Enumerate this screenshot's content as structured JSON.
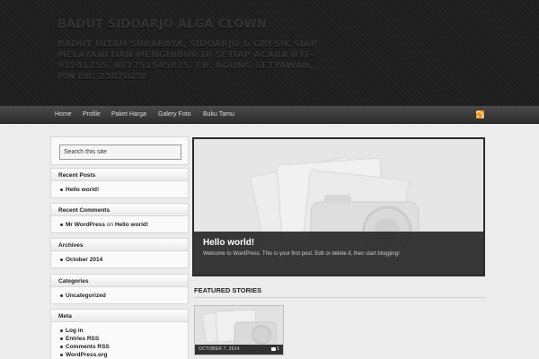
{
  "header": {
    "site_title": "BADUT SIDOARJO ALGA CLOWN",
    "site_description": "BADUT ULTAH SURABAYA, SIDOARJO & GRESIK SIAP MELAYANI DAN MENGHIBUR DI SETIAP ACARA 031-91241255, 087751545835. FB: AGUNG SETYAWAN, PIN BB: 2587025F"
  },
  "nav": {
    "items": [
      "Home",
      "Profile",
      "Paket Harga",
      "Galery Foto",
      "Buku Tamu"
    ],
    "rss_icon": "rss-icon"
  },
  "sidebar": {
    "search_placeholder": "Search this site",
    "recent_posts": {
      "title": "Recent Posts",
      "items": [
        "Hello world!"
      ]
    },
    "recent_comments": {
      "title": "Recent Comments",
      "author": "Mr WordPress",
      "on": "on",
      "post": "Hello world!"
    },
    "archives": {
      "title": "Archives",
      "items": [
        "October 2014"
      ]
    },
    "categories": {
      "title": "Categories",
      "items": [
        "Uncategorized"
      ]
    },
    "meta": {
      "title": "Meta",
      "items": [
        "Log in",
        "Entries RSS",
        "Comments RSS",
        "WordPress.org"
      ]
    }
  },
  "slider": {
    "title": "Hello world!",
    "excerpt": "Welcome to WordPress. This is your first post. Edit or delete it, then start blogging!"
  },
  "featured": {
    "heading": "FEATURED STORIES",
    "story": {
      "date": "OCTOBER 7, 2014",
      "comments": "1"
    }
  },
  "colors": {
    "header_bg": "#1e1e1e",
    "nav_bg": "#3a3a3a",
    "page_bg": "#ececec",
    "rss": "#f7931e"
  }
}
